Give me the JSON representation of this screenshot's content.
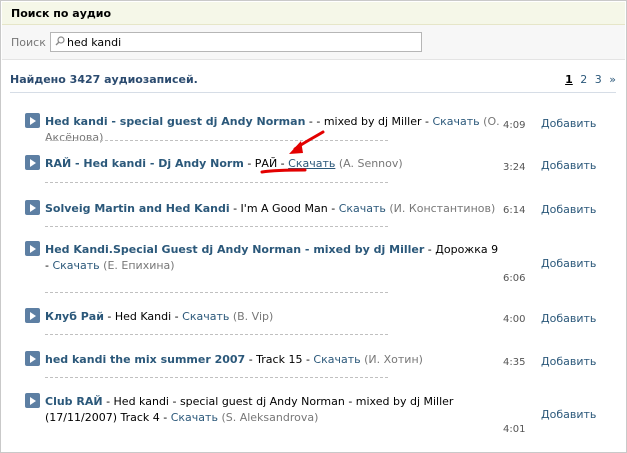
{
  "header": {
    "title": "Поиск по аудио"
  },
  "search": {
    "label": "Поиск",
    "value": "hed kandi"
  },
  "results": {
    "found": "Найдено 3427 аудиозаписей."
  },
  "pagination": {
    "pages": [
      "1",
      "2",
      "3"
    ],
    "current": "1",
    "next": "»"
  },
  "tracks": [
    {
      "artist": "Hed kandi - special guest dj Andy Norman",
      "title": " - - mixed by dj Miller - ",
      "download": "Скачать",
      "user": "(О. Аксёнова)",
      "duration": "4:09",
      "add": "Добавить"
    },
    {
      "artist": "RAЙ - Hed kandi - Dj Andy Norm",
      "title": " - РАЙ - ",
      "download": "Скачать",
      "user": "(A. Sennov)",
      "duration": "3:24",
      "add": "Добавить"
    },
    {
      "artist": "Solveig Martin and Hed Kandi",
      "title": " - I'm A Good Man - ",
      "download": "Скачать",
      "user": "(И. Константинов)",
      "duration": "6:14",
      "add": "Добавить"
    },
    {
      "artist": "Hed Kandi.Special Guest dj Andy Norman - mixed by dj Miller",
      "title": " - Дорожка 9 - ",
      "download": "Скачать",
      "user": "(Е. Епихина)",
      "duration": "6:06",
      "add": "Добавить"
    },
    {
      "artist": "Клуб Рай",
      "title": " - Hed Kandi - ",
      "download": "Скачать",
      "user": "(B. Vip)",
      "duration": "4:00",
      "add": "Добавить"
    },
    {
      "artist": "hed kandi the mix summer 2007",
      "title": " - Track 15 - ",
      "download": "Скачать",
      "user": "(И. Хотин)",
      "duration": "4:35",
      "add": "Добавить"
    },
    {
      "artist": "Club RAЙ",
      "title": " - Hed kandi - special guest dj Andy Norman - mixed by dj Miller (17/11/2007) Track 4 - ",
      "download": "Скачать",
      "user": "(S. Aleksandrova)",
      "duration": "4:01",
      "add": "Добавить"
    }
  ],
  "annotation": {
    "arrow_color": "#e30000"
  },
  "colors": {
    "link": "#2b587a",
    "header_bg": "#f5f7e8",
    "play_button": "#5d7fa3"
  }
}
